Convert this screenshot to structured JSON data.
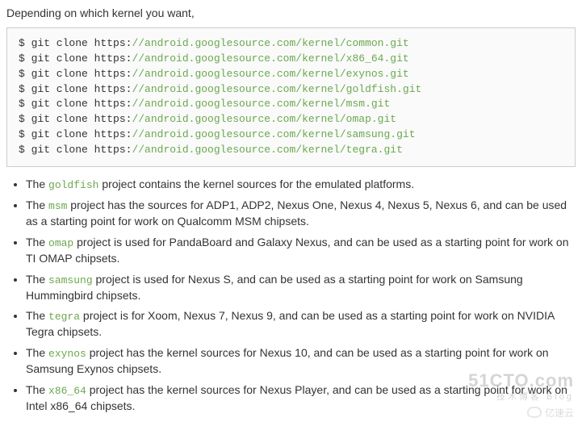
{
  "intro": "Depending on which kernel you want,",
  "code": {
    "lines": [
      {
        "prefix": "$ git clone https:",
        "url": "//android.googlesource.com/kernel/common.git"
      },
      {
        "prefix": "$ git clone https:",
        "url": "//android.googlesource.com/kernel/x86_64.git"
      },
      {
        "prefix": "$ git clone https:",
        "url": "//android.googlesource.com/kernel/exynos.git"
      },
      {
        "prefix": "$ git clone https:",
        "url": "//android.googlesource.com/kernel/goldfish.git"
      },
      {
        "prefix": "$ git clone https:",
        "url": "//android.googlesource.com/kernel/msm.git"
      },
      {
        "prefix": "$ git clone https:",
        "url": "//android.googlesource.com/kernel/omap.git"
      },
      {
        "prefix": "$ git clone https:",
        "url": "//android.googlesource.com/kernel/samsung.git"
      },
      {
        "prefix": "$ git clone https:",
        "url": "//android.googlesource.com/kernel/tegra.git"
      }
    ]
  },
  "bullets": [
    {
      "lead": "The ",
      "kw": "goldfish",
      "tail": " project contains the kernel sources for the emulated platforms."
    },
    {
      "lead": "The ",
      "kw": "msm",
      "tail": " project has the sources for ADP1, ADP2, Nexus One, Nexus 4, Nexus 5, Nexus 6, and can be used as a starting point for work on Qualcomm MSM chipsets."
    },
    {
      "lead": "The ",
      "kw": "omap",
      "tail": " project is used for PandaBoard and Galaxy Nexus, and can be used as a starting point for work on TI OMAP chipsets."
    },
    {
      "lead": "The ",
      "kw": "samsung",
      "tail": " project is used for Nexus S, and can be used as a starting point for work on Samsung Hummingbird chipsets."
    },
    {
      "lead": "The ",
      "kw": "tegra",
      "tail": " project is for Xoom, Nexus 7, Nexus 9, and can be used as a starting point for work on NVIDIA Tegra chipsets."
    },
    {
      "lead": "The ",
      "kw": "exynos",
      "tail": " project has the kernel sources for Nexus 10, and can be used as a starting point for work on Samsung Exynos chipsets."
    },
    {
      "lead": "The ",
      "kw": "x86_64",
      "tail": " project has the kernel sources for Nexus Player, and can be used as a starting point for work on Intel x86_64 chipsets."
    }
  ],
  "watermark": {
    "top": "51CTO.com",
    "sub": "技术博客  Blog",
    "brand": "亿速云"
  }
}
